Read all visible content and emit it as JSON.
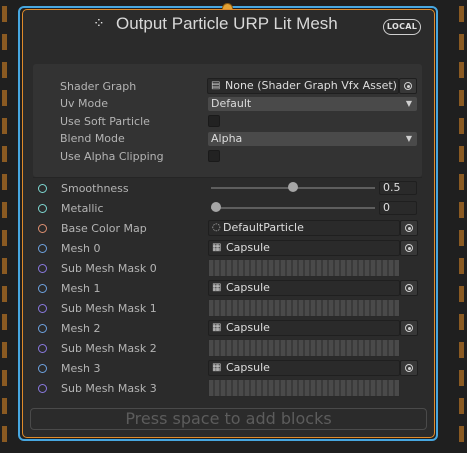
{
  "node": {
    "title": "Output Particle URP Lit Mesh",
    "badge": "LOCAL",
    "icon": "vfx-output-icon"
  },
  "settings": {
    "shader_graph": {
      "label": "Shader Graph",
      "value": "None (Shader Graph Vfx Asset)"
    },
    "uv_mode": {
      "label": "Uv Mode",
      "value": "Default"
    },
    "use_soft_particle": {
      "label": "Use Soft Particle",
      "checked": false
    },
    "blend_mode": {
      "label": "Blend Mode",
      "value": "Alpha"
    },
    "use_alpha_clipping": {
      "label": "Use Alpha Clipping",
      "checked": false
    }
  },
  "properties": {
    "smoothness": {
      "label": "Smoothness",
      "value": "0.5",
      "slider": 0.5
    },
    "metallic": {
      "label": "Metallic",
      "value": "0",
      "slider": 0.0
    },
    "base_color_map": {
      "label": "Base Color Map",
      "value": "DefaultParticle"
    },
    "mesh_0": {
      "label": "Mesh 0",
      "value": "Capsule"
    },
    "sub_mesh_mask_0": {
      "label": "Sub Mesh Mask 0"
    },
    "mesh_1": {
      "label": "Mesh 1",
      "value": "Capsule"
    },
    "sub_mesh_mask_1": {
      "label": "Sub Mesh Mask 1"
    },
    "mesh_2": {
      "label": "Mesh 2",
      "value": "Capsule"
    },
    "sub_mesh_mask_2": {
      "label": "Sub Mesh Mask 2"
    },
    "mesh_3": {
      "label": "Mesh 3",
      "value": "Capsule"
    },
    "sub_mesh_mask_3": {
      "label": "Sub Mesh Mask 3"
    }
  },
  "footer": {
    "add_blocks_hint": "Press space to add blocks"
  },
  "colors": {
    "selection": "#47a7e0",
    "context_border": "#e08b2a",
    "flow_port": "#e2a235"
  }
}
